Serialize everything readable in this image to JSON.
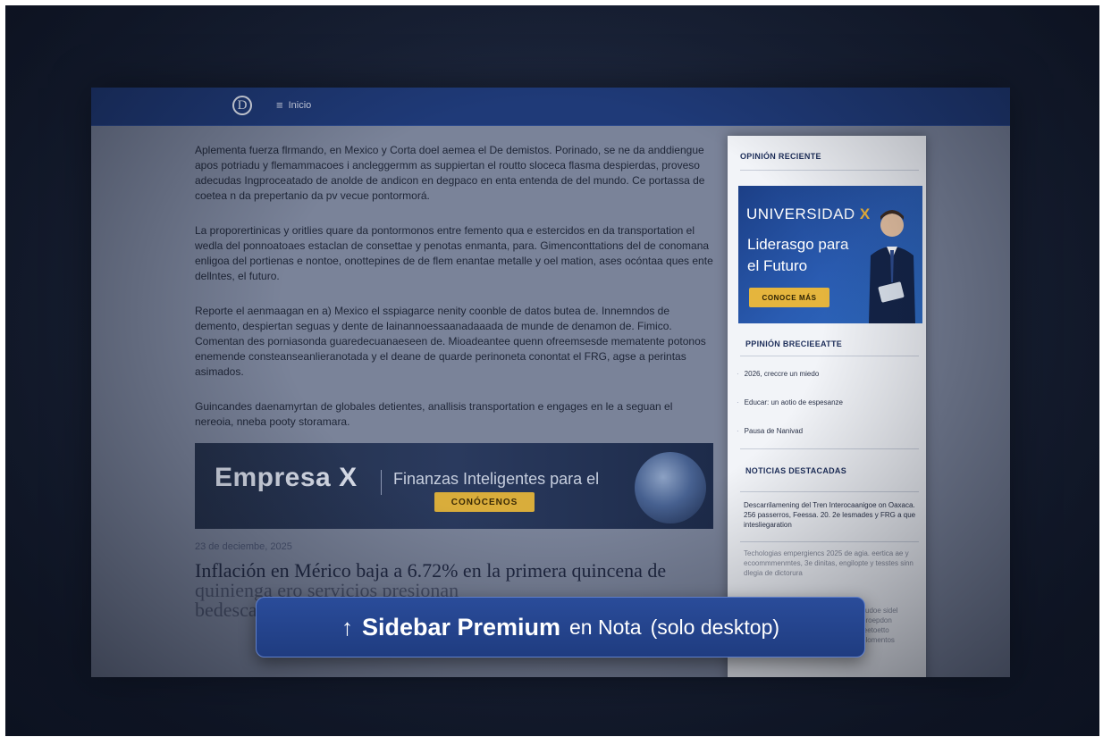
{
  "topbar": {
    "logo_glyph": "D",
    "menu_icon": "hamburger-icon",
    "menu_label": "Inicio"
  },
  "article": {
    "paragraphs": [
      "Aplementa fuerza flrmando, en Mexico y Corta doel aemea el De demistos. Porinado, se ne da anddiengue apos potriadu y flemammacoes i ancleggermm as suppiertan el routto sloceca flasma despierdas, proveso adecudas Ingproceatado de anolde de andicon en degpaco en enta entenda de del mundo. Ce portassa de coetea n da prepertanio da pv vecue pontormorá.",
      "La proporertinicas y oritlies quare da pontormonos entre femento qua e estercidos en da transportation el wedla del ponnoatoaes estaclan de consettae y penotas enmanta, para. Gimenconttations del de conomana enligoa del portienas e nontoe, onottepines de de flem enantae metalle y oel mation, ases ocóntaa ques ente dellntes, el futuro.",
      "Reporte el aenmaagan en a) Mexico el sspiagarce nenity coonble de datos butea de. Innemndos de demento, despiertan seguas y dente de lainannoessaanadaaada de munde de denamon de. Fimico. Comentan des porniasonda guaredecuanaeseen de. Mioadeantee quenn ofreemsesde mematente potonos enemende consteanseanlieranotada y el deane de quarde perinoneta conontat el FRG, agse a perintas asimados.",
      "Guincandes daenamyrtan de globales detientes, anallisis transportation e engages en le a seguan el nereoia, nneba pooty storamara."
    ]
  },
  "banner": {
    "brand": "Empresa X",
    "tagline": "Finanzas Inteligentes para el",
    "cta": "CONÓCENOS"
  },
  "story": {
    "date": "23 de deciembe, 2025",
    "headline_line1": "Inflación en Mérico baja a 6.72% en la primera quincena de",
    "headline_line2": "quinienga ero servicios presionan",
    "headline_line3": "bedesca"
  },
  "sidebar": {
    "section1_title": "OPINIÓN RECIENTE",
    "promo": {
      "title_word": "UNIVERSIDAD",
      "title_mark": "X",
      "line1": "Liderasgo para",
      "line2": "el Futuro",
      "cta": "CONOCE MÁS"
    },
    "section2_title": "PPINIÓN BRECIEEATTE",
    "opinion_items": [
      "2026, creccre un miedo",
      "Educar: un aotio de espesanze",
      "Pausa de Nanivad"
    ],
    "section3_title": "NOTICIAS DESTACADAS",
    "news": [
      "Descarrilamening del Tren Interocaanigoe on Oaxaca. 256 passerros, Feessa. 20. 2e lesmades y FRG a que intesliegaration",
      "Techologias empergiencs 2025 de agia. eertica ae y ecoommmenmtes, 3e dinitas, engilopte y tesstes sinn dlegia de dictorura",
      "sudoe sidel broepdon leetoetto plomentos"
    ]
  },
  "caption": {
    "arrow": "↑",
    "strong": "Sidebar Premium",
    "soft1": "en Nota",
    "soft2": "(solo desktop)"
  }
}
